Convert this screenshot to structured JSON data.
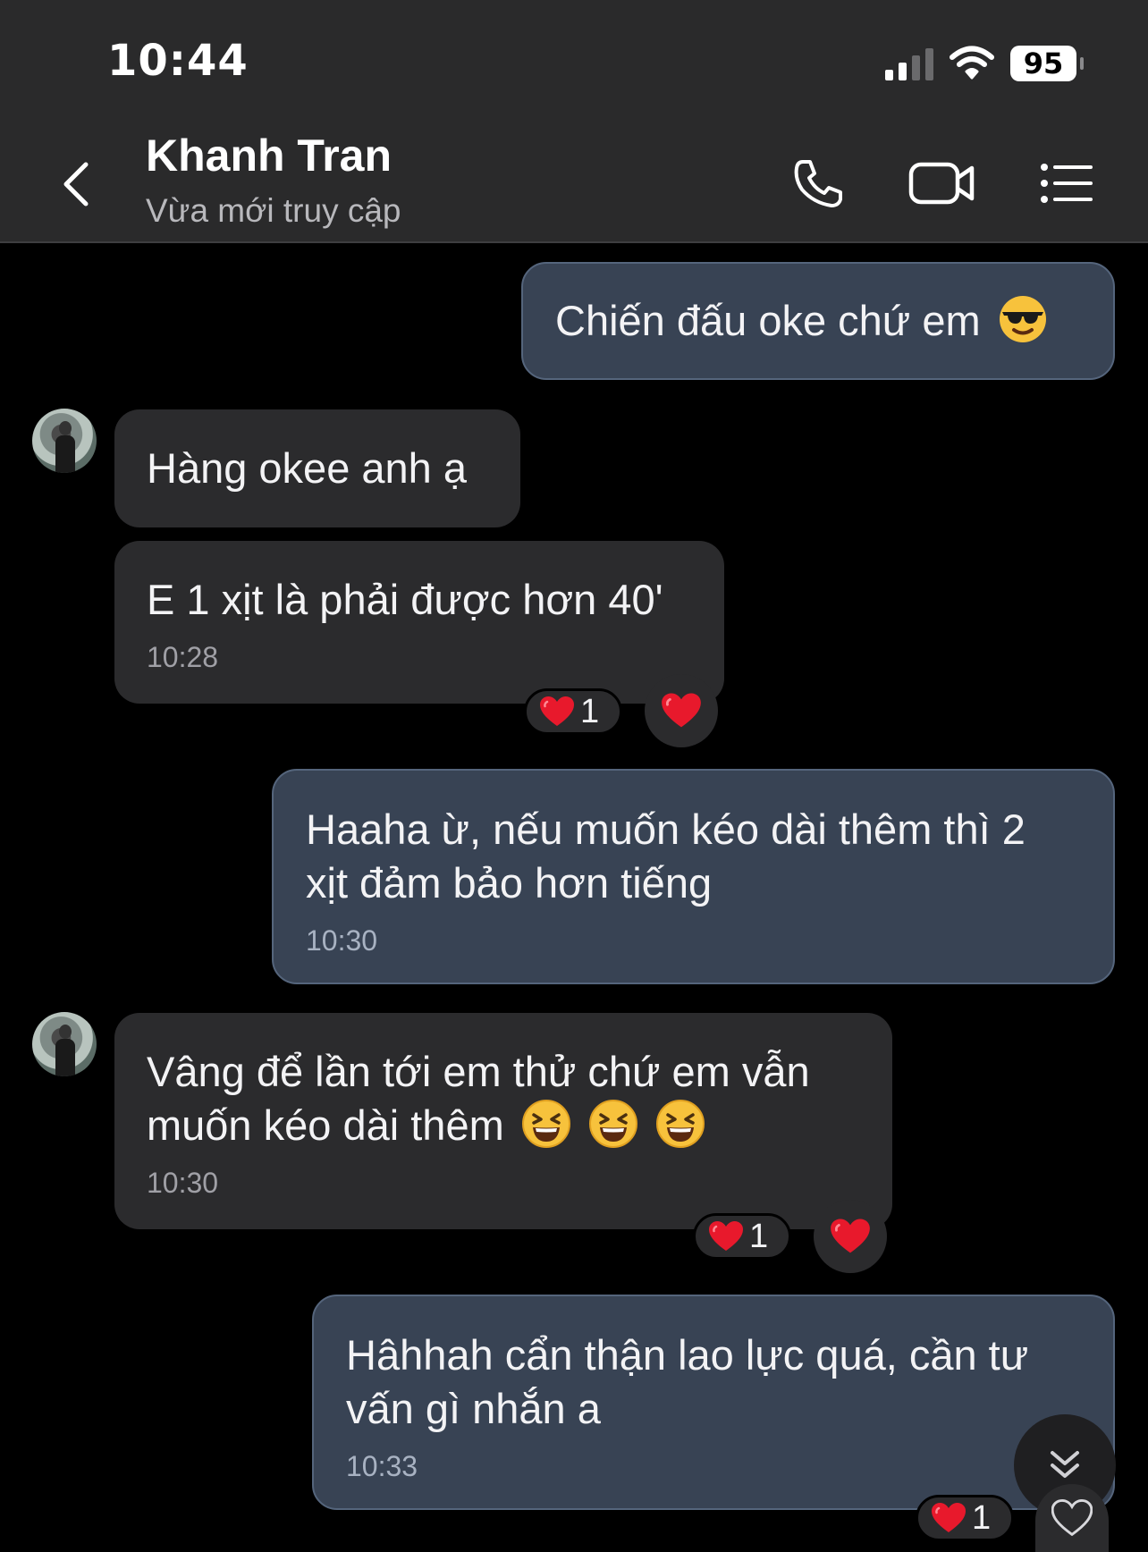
{
  "status_bar": {
    "time": "10:44",
    "battery": "95"
  },
  "header": {
    "contact_name": "Khanh Tran",
    "contact_status": "Vừa mới truy cập",
    "icons": [
      "back-chevron-icon",
      "phone-icon",
      "video-call-icon",
      "menu-list-icon"
    ]
  },
  "messages": [
    {
      "direction": "out",
      "text": "Chiến đấu oke chứ em",
      "emoji": "sunglasses-emoji"
    },
    {
      "direction": "in",
      "text": "Hàng okee anh ạ"
    },
    {
      "direction": "in",
      "text": "E 1 xịt là phải được hơn 40'",
      "time": "10:28",
      "reaction_count": "1"
    },
    {
      "direction": "out",
      "line1": "Haaha ừ, nếu muốn kéo dài thêm thì 2",
      "line2": "xịt đảm bảo hơn tiếng",
      "time": "10:30"
    },
    {
      "direction": "in",
      "line1": "Vâng để lần tới em thử chứ em vẫn",
      "line2": "muốn kéo dài thêm",
      "emoji": "laughing-emoji x3",
      "time": "10:30",
      "reaction_count": "1"
    },
    {
      "direction": "out",
      "line1": "Hâhhah cẩn thận lao lực quá, cần tư",
      "line2": "vấn gì nhắn a",
      "time": "10:33",
      "reaction_count": "1"
    }
  ],
  "colors": {
    "header_bg": "#2a2a2b",
    "incoming_bubble": "#2b2b2d",
    "outgoing_bubble": "#384354",
    "heart": "#e8192c"
  }
}
